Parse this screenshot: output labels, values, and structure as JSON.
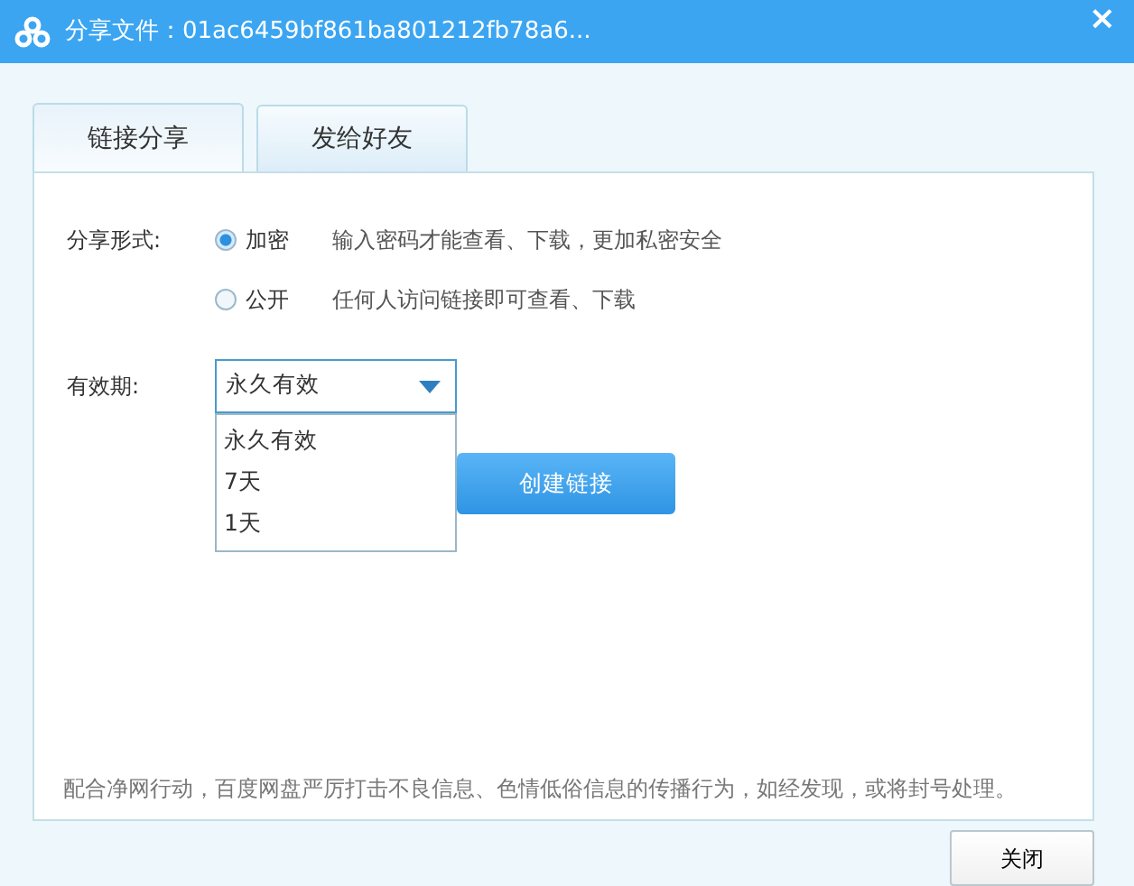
{
  "window": {
    "title": "分享文件：01ac6459bf861ba801212fb78a6...",
    "close": "×"
  },
  "tabs": [
    {
      "label": "链接分享",
      "selected": true
    },
    {
      "label": "发给好友",
      "selected": false
    }
  ],
  "share_mode": {
    "label": "分享形式:",
    "options": [
      {
        "label": "加密",
        "description": "输入密码才能查看、下载，更加私密安全",
        "selected": true
      },
      {
        "label": "公开",
        "description": "任何人访问链接即可查看、下载",
        "selected": false
      }
    ]
  },
  "validity": {
    "label": "有效期:",
    "value": "永久有效",
    "expanded": true,
    "options": [
      "永久有效",
      "7天",
      "1天"
    ]
  },
  "create_button": "创建链接",
  "notice": "配合净网行动，百度网盘严厉打击不良信息、色情低俗信息的传播行为，如经发现，或将封号处理。",
  "close_button": "关闭"
}
